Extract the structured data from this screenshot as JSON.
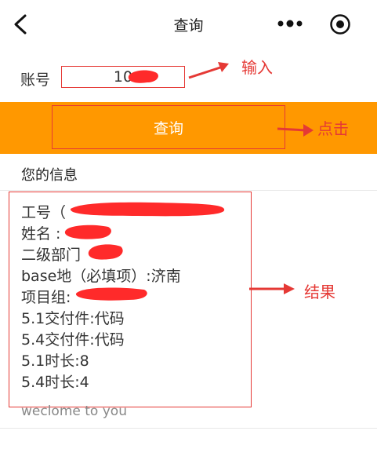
{
  "nav": {
    "title": "查询"
  },
  "account": {
    "label": "账号",
    "value": "10"
  },
  "query_button": {
    "label": "查询"
  },
  "annotations": {
    "input": "输入",
    "click": "点击",
    "result": "结果"
  },
  "info": {
    "heading": "您的信息",
    "lines": [
      "工号（",
      "姓名 :",
      "二级部门",
      "base地（必填项）:济南",
      "项目组:",
      "5.1交付件:代码",
      "5.4交付件:代码",
      "5.1时长:8",
      "5.4时长:4"
    ]
  },
  "welcome": "weclome to you",
  "colors": {
    "accent": "#ff9800",
    "annotation": "#e53935",
    "redaction": "#ff2a2a"
  }
}
